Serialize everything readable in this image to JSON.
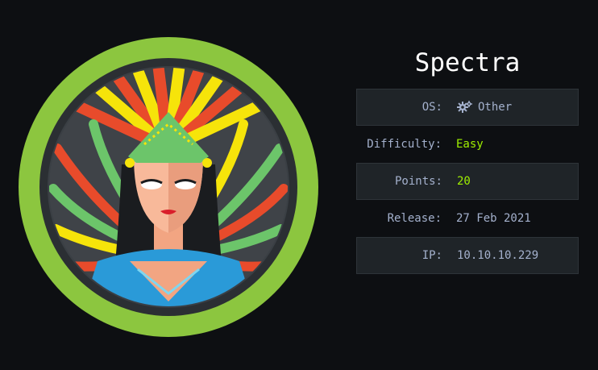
{
  "machine": {
    "name": "Spectra",
    "avatar_description_icon": "spectra-avatar",
    "accent_color": "#8cc63f"
  },
  "info": [
    {
      "label": "OS:",
      "value": "Other",
      "icon": "gears-icon"
    },
    {
      "label": "Difficulty:",
      "value": "Easy",
      "value_color": "#9fef00"
    },
    {
      "label": "Points:",
      "value": "20",
      "value_color": "#9fef00"
    },
    {
      "label": "Release:",
      "value": "27 Feb 2021"
    },
    {
      "label": "IP:",
      "value": "10.10.10.229"
    }
  ]
}
